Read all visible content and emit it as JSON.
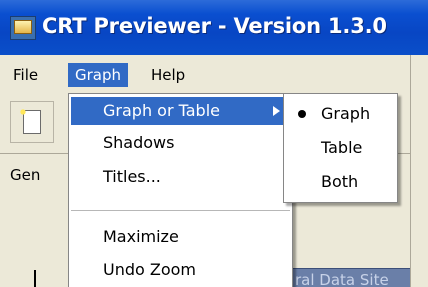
{
  "window": {
    "title": "CRT Previewer - Version 1.3.0"
  },
  "menubar": {
    "items": [
      {
        "label": "File"
      },
      {
        "label": "Graph"
      },
      {
        "label": "Help"
      }
    ]
  },
  "tab": {
    "label": "Gen"
  },
  "graph_menu": {
    "items": [
      {
        "label": "Graph or Table"
      },
      {
        "label": "Shadows"
      },
      {
        "label": "Titles..."
      },
      {
        "label": "Maximize"
      },
      {
        "label": "Undo Zoom"
      }
    ]
  },
  "submenu": {
    "items": [
      {
        "label": "Graph",
        "checked": true
      },
      {
        "label": "Table",
        "checked": false
      },
      {
        "label": "Both",
        "checked": false
      }
    ]
  },
  "status": {
    "link_text": "ral Data Site"
  },
  "colors": {
    "title_bar": "#0a4fd0",
    "highlight": "#316ac5",
    "face": "#ece9d8"
  }
}
